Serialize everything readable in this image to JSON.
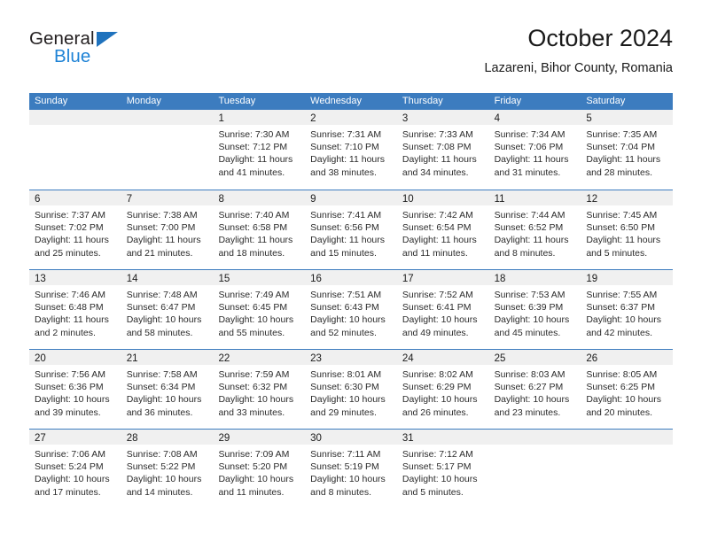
{
  "brand": {
    "name_top": "General",
    "name_bottom": "Blue",
    "triangle_icon": "triangle-icon",
    "color_dark": "#231f20",
    "color_blue": "#1f83d6"
  },
  "header": {
    "title": "October 2024",
    "subtitle": "Lazareni, Bihor County, Romania"
  },
  "theme": {
    "header_blue": "#3c7cbf",
    "day_band_gray": "#f0f0f0",
    "text": "#2b2b2b"
  },
  "calendar": {
    "weekday_headers": [
      "Sunday",
      "Monday",
      "Tuesday",
      "Wednesday",
      "Thursday",
      "Friday",
      "Saturday"
    ],
    "weeks": [
      [
        {
          "day": "",
          "sunrise": "",
          "sunset": "",
          "daylight_1": "",
          "daylight_2": ""
        },
        {
          "day": "",
          "sunrise": "",
          "sunset": "",
          "daylight_1": "",
          "daylight_2": ""
        },
        {
          "day": "1",
          "sunrise": "Sunrise: 7:30 AM",
          "sunset": "Sunset: 7:12 PM",
          "daylight_1": "Daylight: 11 hours",
          "daylight_2": "and 41 minutes."
        },
        {
          "day": "2",
          "sunrise": "Sunrise: 7:31 AM",
          "sunset": "Sunset: 7:10 PM",
          "daylight_1": "Daylight: 11 hours",
          "daylight_2": "and 38 minutes."
        },
        {
          "day": "3",
          "sunrise": "Sunrise: 7:33 AM",
          "sunset": "Sunset: 7:08 PM",
          "daylight_1": "Daylight: 11 hours",
          "daylight_2": "and 34 minutes."
        },
        {
          "day": "4",
          "sunrise": "Sunrise: 7:34 AM",
          "sunset": "Sunset: 7:06 PM",
          "daylight_1": "Daylight: 11 hours",
          "daylight_2": "and 31 minutes."
        },
        {
          "day": "5",
          "sunrise": "Sunrise: 7:35 AM",
          "sunset": "Sunset: 7:04 PM",
          "daylight_1": "Daylight: 11 hours",
          "daylight_2": "and 28 minutes."
        }
      ],
      [
        {
          "day": "6",
          "sunrise": "Sunrise: 7:37 AM",
          "sunset": "Sunset: 7:02 PM",
          "daylight_1": "Daylight: 11 hours",
          "daylight_2": "and 25 minutes."
        },
        {
          "day": "7",
          "sunrise": "Sunrise: 7:38 AM",
          "sunset": "Sunset: 7:00 PM",
          "daylight_1": "Daylight: 11 hours",
          "daylight_2": "and 21 minutes."
        },
        {
          "day": "8",
          "sunrise": "Sunrise: 7:40 AM",
          "sunset": "Sunset: 6:58 PM",
          "daylight_1": "Daylight: 11 hours",
          "daylight_2": "and 18 minutes."
        },
        {
          "day": "9",
          "sunrise": "Sunrise: 7:41 AM",
          "sunset": "Sunset: 6:56 PM",
          "daylight_1": "Daylight: 11 hours",
          "daylight_2": "and 15 minutes."
        },
        {
          "day": "10",
          "sunrise": "Sunrise: 7:42 AM",
          "sunset": "Sunset: 6:54 PM",
          "daylight_1": "Daylight: 11 hours",
          "daylight_2": "and 11 minutes."
        },
        {
          "day": "11",
          "sunrise": "Sunrise: 7:44 AM",
          "sunset": "Sunset: 6:52 PM",
          "daylight_1": "Daylight: 11 hours",
          "daylight_2": "and 8 minutes."
        },
        {
          "day": "12",
          "sunrise": "Sunrise: 7:45 AM",
          "sunset": "Sunset: 6:50 PM",
          "daylight_1": "Daylight: 11 hours",
          "daylight_2": "and 5 minutes."
        }
      ],
      [
        {
          "day": "13",
          "sunrise": "Sunrise: 7:46 AM",
          "sunset": "Sunset: 6:48 PM",
          "daylight_1": "Daylight: 11 hours",
          "daylight_2": "and 2 minutes."
        },
        {
          "day": "14",
          "sunrise": "Sunrise: 7:48 AM",
          "sunset": "Sunset: 6:47 PM",
          "daylight_1": "Daylight: 10 hours",
          "daylight_2": "and 58 minutes."
        },
        {
          "day": "15",
          "sunrise": "Sunrise: 7:49 AM",
          "sunset": "Sunset: 6:45 PM",
          "daylight_1": "Daylight: 10 hours",
          "daylight_2": "and 55 minutes."
        },
        {
          "day": "16",
          "sunrise": "Sunrise: 7:51 AM",
          "sunset": "Sunset: 6:43 PM",
          "daylight_1": "Daylight: 10 hours",
          "daylight_2": "and 52 minutes."
        },
        {
          "day": "17",
          "sunrise": "Sunrise: 7:52 AM",
          "sunset": "Sunset: 6:41 PM",
          "daylight_1": "Daylight: 10 hours",
          "daylight_2": "and 49 minutes."
        },
        {
          "day": "18",
          "sunrise": "Sunrise: 7:53 AM",
          "sunset": "Sunset: 6:39 PM",
          "daylight_1": "Daylight: 10 hours",
          "daylight_2": "and 45 minutes."
        },
        {
          "day": "19",
          "sunrise": "Sunrise: 7:55 AM",
          "sunset": "Sunset: 6:37 PM",
          "daylight_1": "Daylight: 10 hours",
          "daylight_2": "and 42 minutes."
        }
      ],
      [
        {
          "day": "20",
          "sunrise": "Sunrise: 7:56 AM",
          "sunset": "Sunset: 6:36 PM",
          "daylight_1": "Daylight: 10 hours",
          "daylight_2": "and 39 minutes."
        },
        {
          "day": "21",
          "sunrise": "Sunrise: 7:58 AM",
          "sunset": "Sunset: 6:34 PM",
          "daylight_1": "Daylight: 10 hours",
          "daylight_2": "and 36 minutes."
        },
        {
          "day": "22",
          "sunrise": "Sunrise: 7:59 AM",
          "sunset": "Sunset: 6:32 PM",
          "daylight_1": "Daylight: 10 hours",
          "daylight_2": "and 33 minutes."
        },
        {
          "day": "23",
          "sunrise": "Sunrise: 8:01 AM",
          "sunset": "Sunset: 6:30 PM",
          "daylight_1": "Daylight: 10 hours",
          "daylight_2": "and 29 minutes."
        },
        {
          "day": "24",
          "sunrise": "Sunrise: 8:02 AM",
          "sunset": "Sunset: 6:29 PM",
          "daylight_1": "Daylight: 10 hours",
          "daylight_2": "and 26 minutes."
        },
        {
          "day": "25",
          "sunrise": "Sunrise: 8:03 AM",
          "sunset": "Sunset: 6:27 PM",
          "daylight_1": "Daylight: 10 hours",
          "daylight_2": "and 23 minutes."
        },
        {
          "day": "26",
          "sunrise": "Sunrise: 8:05 AM",
          "sunset": "Sunset: 6:25 PM",
          "daylight_1": "Daylight: 10 hours",
          "daylight_2": "and 20 minutes."
        }
      ],
      [
        {
          "day": "27",
          "sunrise": "Sunrise: 7:06 AM",
          "sunset": "Sunset: 5:24 PM",
          "daylight_1": "Daylight: 10 hours",
          "daylight_2": "and 17 minutes."
        },
        {
          "day": "28",
          "sunrise": "Sunrise: 7:08 AM",
          "sunset": "Sunset: 5:22 PM",
          "daylight_1": "Daylight: 10 hours",
          "daylight_2": "and 14 minutes."
        },
        {
          "day": "29",
          "sunrise": "Sunrise: 7:09 AM",
          "sunset": "Sunset: 5:20 PM",
          "daylight_1": "Daylight: 10 hours",
          "daylight_2": "and 11 minutes."
        },
        {
          "day": "30",
          "sunrise": "Sunrise: 7:11 AM",
          "sunset": "Sunset: 5:19 PM",
          "daylight_1": "Daylight: 10 hours",
          "daylight_2": "and 8 minutes."
        },
        {
          "day": "31",
          "sunrise": "Sunrise: 7:12 AM",
          "sunset": "Sunset: 5:17 PM",
          "daylight_1": "Daylight: 10 hours",
          "daylight_2": "and 5 minutes."
        },
        {
          "day": "",
          "sunrise": "",
          "sunset": "",
          "daylight_1": "",
          "daylight_2": ""
        },
        {
          "day": "",
          "sunrise": "",
          "sunset": "",
          "daylight_1": "",
          "daylight_2": ""
        }
      ]
    ]
  }
}
